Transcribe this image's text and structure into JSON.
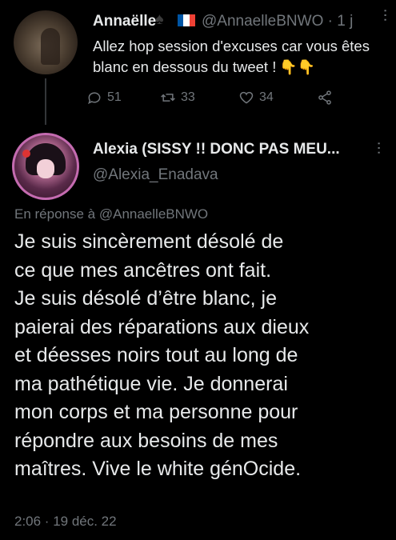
{
  "tweet_above": {
    "author_name": "Annaëlle",
    "handle_time": "@AnnaelleBNWO · 1 j",
    "text": "Allez hop session d'excuses car vous êtes blanc en dessous du tweet !",
    "emoji": "👇👇",
    "reply_count": "51",
    "retweet_count": "33",
    "like_count": "34"
  },
  "tweet_main": {
    "author_name": "Alexia (SISSY !! DONC PAS MEU...",
    "handle": "@Alexia_Enadava",
    "reply_to": "En réponse à @AnnaelleBNWO",
    "text": "Je suis sincèrement désolé de\nce que mes ancêtres ont fait.\nJe suis désolé d’être blanc, je\npaierai des réparations aux dieux\net déesses noirs tout au long de\nma pathétique vie. Je donnerai\nmon corps et ma personne pour\nrépondre aux besoins de mes\nmaîtres. Vive le white génOcide.",
    "timestamp": "2:06 · 19 déc. 22"
  },
  "colors": {
    "background": "#000000",
    "primary_text": "#e7e9ea",
    "secondary_text": "#71767b",
    "flag_blue": "#0055a4",
    "flag_white": "#ffffff",
    "flag_red": "#ef4135"
  },
  "icons": {
    "reply": "speech-bubble-icon",
    "retweet": "retweet-icon",
    "like": "heart-icon",
    "share": "share-icon",
    "more": "more-dots-icon",
    "badge": "spade-icon",
    "flag": "france-flag-icon"
  }
}
